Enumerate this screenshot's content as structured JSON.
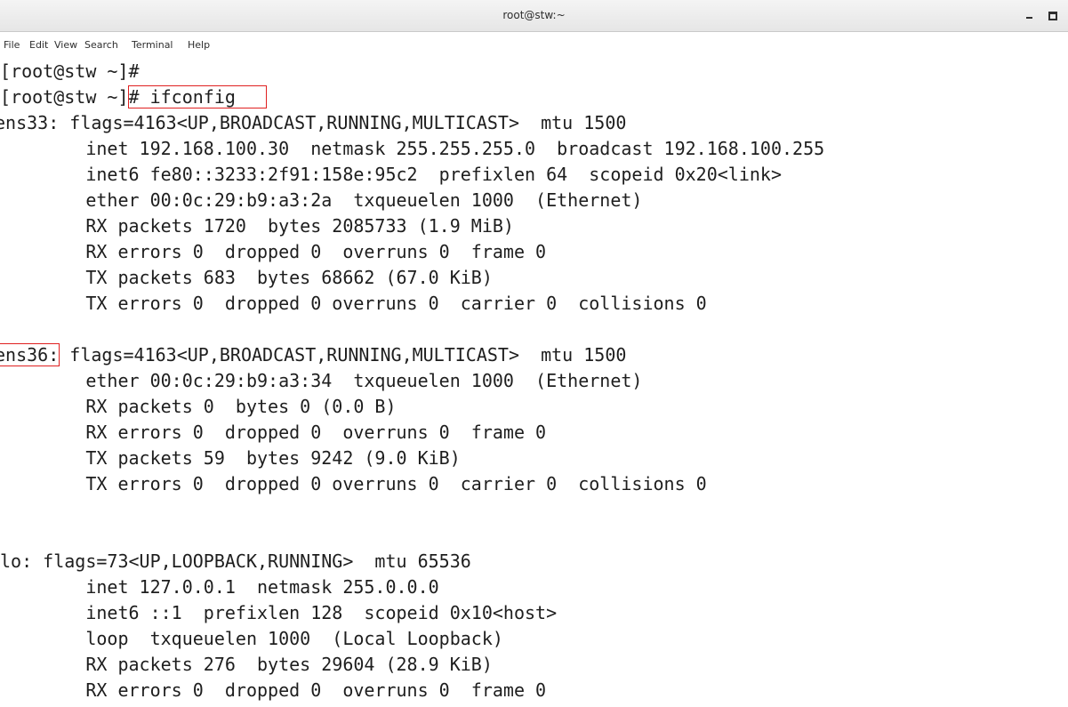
{
  "window": {
    "title": "root@stw:~",
    "minimize_icon": "minimize-icon",
    "maximize_icon": "maximize-icon"
  },
  "menu": [
    "File",
    "Edit",
    "View",
    "Search",
    "Terminal",
    "Help"
  ],
  "terminal": {
    "lines": [
      "[root@stw ~]#",
      "[root@stw ~]",
      "# ifconfig",
      "ens33: flags=4163<UP,BROADCAST,RUNNING,MULTICAST>  mtu 1500",
      "        inet 192.168.100.30  netmask 255.255.255.0  broadcast 192.168.100.255",
      "        inet6 fe80::3233:2f91:158e:95c2  prefixlen 64  scopeid 0x20<link>",
      "        ether 00:0c:29:b9:a3:2a  txqueuelen 1000  (Ethernet)",
      "        RX packets 1720  bytes 2085733 (1.9 MiB)",
      "        RX errors 0  dropped 0  overruns 0  frame 0",
      "        TX packets 683  bytes 68662 (67.0 KiB)",
      "        TX errors 0  dropped 0 overruns 0  carrier 0  collisions 0",
      "ens36:",
      " flags=4163<UP,BROADCAST,RUNNING,MULTICAST>  mtu 1500",
      "        ether 00:0c:29:b9:a3:34  txqueuelen 1000  (Ethernet)",
      "        RX packets 0  bytes 0 (0.0 B)",
      "        RX errors 0  dropped 0  overruns 0  frame 0",
      "        TX packets 59  bytes 9242 (9.0 KiB)",
      "        TX errors 0  dropped 0 overruns 0  carrier 0  collisions 0",
      "lo: flags=73<UP,LOOPBACK,RUNNING>  mtu 65536",
      "        inet 127.0.0.1  netmask 255.0.0.0",
      "        inet6 ::1  prefixlen 128  scopeid 0x10<host>",
      "        loop  txqueuelen 1000  (Local Loopback)",
      "        RX packets 276  bytes 29604 (28.9 KiB)",
      "        RX errors 0  dropped 0  overruns 0  frame 0"
    ]
  }
}
